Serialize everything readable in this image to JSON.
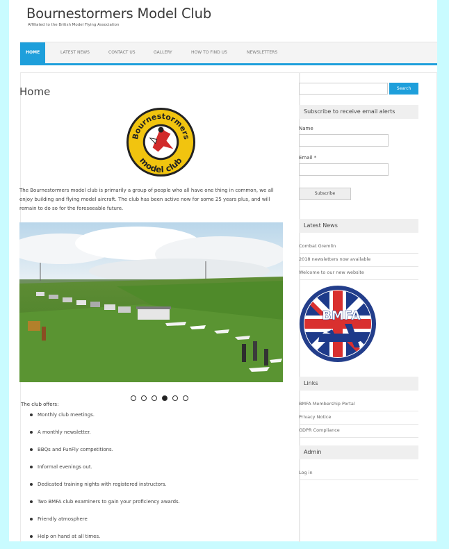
{
  "site": {
    "title": "Bournestormers Model Club",
    "description": "Affiliated to the British Model Flying Association"
  },
  "nav": {
    "items": [
      {
        "label": "HOME",
        "active": true
      },
      {
        "label": "LATEST NEWS",
        "active": false
      },
      {
        "label": "CONTACT US",
        "active": false
      },
      {
        "label": "GALLERY",
        "active": false
      },
      {
        "label": "HOW TO FIND US",
        "active": false
      },
      {
        "label": "NEWSLETTERS",
        "active": false
      }
    ]
  },
  "main": {
    "page_title": "Home",
    "club_logo": {
      "line1": "Bournestormers",
      "line2": "model club"
    },
    "intro": "The Bournestormers model club is primarily a group of people who all have one thing in common, we all enjoy building and flying model aircraft. The club has been active now for some 25 years plus, and will remain to do so for the foreseeable future.",
    "slider": {
      "slide_count": 6,
      "active_index": 3
    },
    "offers_title": "The club offers:",
    "offers": [
      "Monthly club meetings.",
      "A monthly newsletter.",
      "BBQs and FunFly competitions.",
      "Informal evenings out.",
      "Dedicated training nights with registered instructors.",
      "Two BMFA club examiners to gain your proficiency awards.",
      "Friendly atmosphere",
      "Help on hand at all times."
    ]
  },
  "sidebar": {
    "search": {
      "placeholder": "",
      "button_label": "Search"
    },
    "subscribe": {
      "title": "Subscribe to receive email alerts",
      "name_label": "Name",
      "email_label": "Email *",
      "button_label": "Subscribe"
    },
    "latest_news": {
      "title": "Latest News",
      "items": [
        "Combat Gremlin",
        "2018 newsletters now available",
        "Welcome to our new website"
      ]
    },
    "bmfa_logo": {
      "text": "BMFA"
    },
    "links": {
      "title": "Links",
      "items": [
        "BMFA Membership Portal",
        "Privacy Notice",
        "GDPR Compliance"
      ]
    },
    "admin": {
      "title": "Admin",
      "items": [
        "Log in"
      ]
    }
  },
  "colors": {
    "accent": "#1e9fdb",
    "page_background": "#c9fbff",
    "widget_background": "#efefef"
  }
}
